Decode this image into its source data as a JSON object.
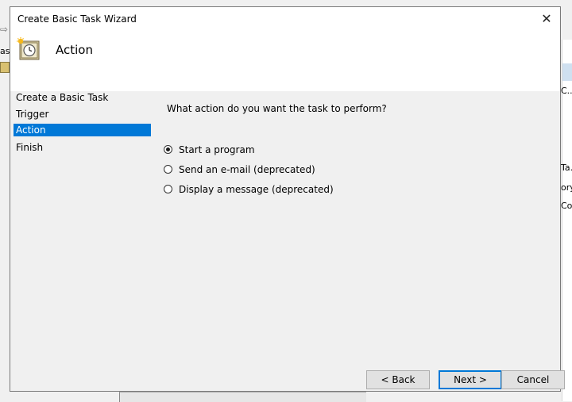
{
  "dialog": {
    "title": "Create Basic Task Wizard",
    "close_glyph": "✕",
    "header_title": "Action",
    "header_icon": "clock-task-icon"
  },
  "nav": {
    "items": [
      {
        "label": "Create a Basic Task",
        "active": false
      },
      {
        "label": "Trigger",
        "active": false
      },
      {
        "label": "Action",
        "active": true
      },
      {
        "label": "Finish",
        "active": false
      }
    ]
  },
  "content": {
    "question": "What action do you want the task to perform?",
    "options": [
      {
        "label": "Start a program",
        "checked": true
      },
      {
        "label": "Send an e-mail (deprecated)",
        "checked": false
      },
      {
        "label": "Display a message (deprecated)",
        "checked": false
      }
    ]
  },
  "buttons": {
    "back": "< Back",
    "next": "Next >",
    "cancel": "Cancel"
  },
  "background": {
    "left_text": "as",
    "right_texts": [
      "C...",
      "Ta...",
      "ory",
      "Co..."
    ]
  },
  "colors": {
    "accent": "#0078d7",
    "window_bg": "#f0f0f0",
    "header_bg": "#ffffff"
  }
}
